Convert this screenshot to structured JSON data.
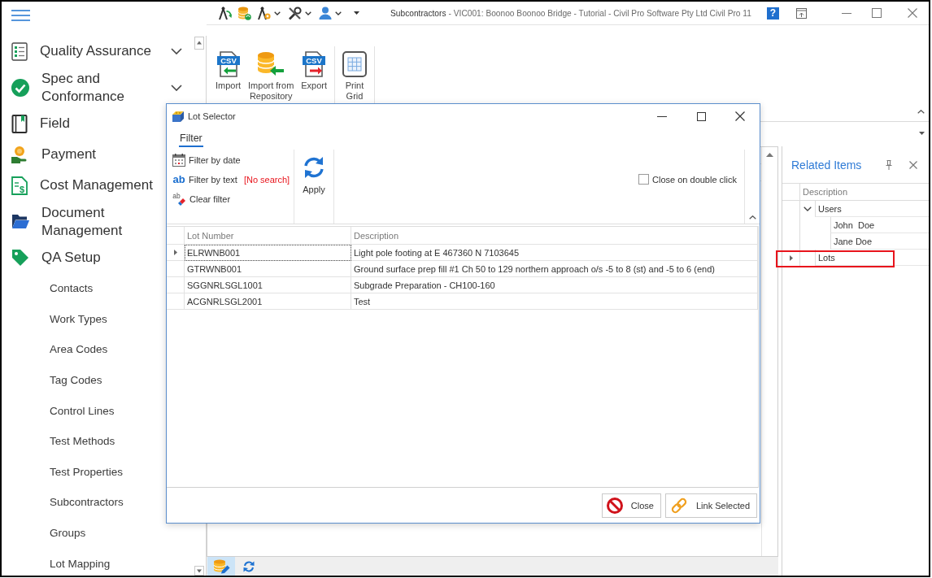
{
  "title_bar": {
    "module": "Subcontractors",
    "context": "- VIC001: Boonoo Boonoo Bridge - Tutorial - Civil Pro Software Pty Ltd Civil Pro 11",
    "help": "?"
  },
  "sidebar": {
    "items": [
      {
        "label": "Quality Assurance",
        "expanded": false
      },
      {
        "label": "Spec and Conformance",
        "expanded": false
      },
      {
        "label": "Field"
      },
      {
        "label": "Payment"
      },
      {
        "label": "Cost Management",
        "icon_text": "$"
      },
      {
        "label": "Document Management"
      },
      {
        "label": "QA Setup",
        "expanded": true,
        "children": [
          {
            "label": "Contacts"
          },
          {
            "label": "Work Types"
          },
          {
            "label": "Area Codes"
          },
          {
            "label": "Tag Codes"
          },
          {
            "label": "Control Lines"
          },
          {
            "label": "Test Methods"
          },
          {
            "label": "Test Properties"
          },
          {
            "label": "Subcontractors"
          },
          {
            "label": "Groups"
          },
          {
            "label": "Lot Mapping"
          }
        ]
      }
    ]
  },
  "ribbon": {
    "groups": [
      {
        "buttons": [
          {
            "label": "Import",
            "icon_text": "CSV"
          },
          {
            "label": "Import from Repository"
          },
          {
            "label": "Export",
            "icon_text": "CSV"
          }
        ]
      },
      {
        "buttons": [
          {
            "label": "Print Grid"
          }
        ]
      }
    ]
  },
  "lot_selector": {
    "title": "Lot Selector",
    "tabs": [
      {
        "label": "Filter",
        "selected": true
      }
    ],
    "filters": [
      {
        "label": "Filter by date"
      },
      {
        "label": "Filter by text",
        "icon_text": "ab",
        "status": "[No search]"
      },
      {
        "label": "Clear filter",
        "icon_text": "ab"
      }
    ],
    "apply": "Apply",
    "close_on_double_click": {
      "label": "Close on double click",
      "checked": false
    },
    "table": {
      "columns": [
        "Lot Number",
        "Description"
      ],
      "rows": [
        {
          "cells": [
            "ELRWNB001",
            "Light pole footing at E 467360 N 7103645"
          ],
          "selected": true
        },
        {
          "cells": [
            "GTRWNB001",
            "Ground surface prep fill #1 Ch 50 to 129 northern approach o/s -5 to 8 (st) and -5 to 6 (end)"
          ],
          "selected": false
        },
        {
          "cells": [
            "SGGNRLSGL1001",
            "Subgrade Preparation - CH100-160"
          ],
          "selected": false
        },
        {
          "cells": [
            "ACGNRLSGL2001",
            "Test"
          ],
          "selected": false
        }
      ]
    },
    "buttons": [
      {
        "label": "Close"
      },
      {
        "label": "Link Selected"
      }
    ]
  },
  "related_items": {
    "title": "Related Items",
    "columns": [
      "Description"
    ],
    "tree": [
      {
        "label": "Users",
        "expanded": true,
        "selected": false,
        "highlighted": false,
        "children": [
          {
            "label": "John  Doe",
            "selected": false,
            "highlighted": false
          },
          {
            "label": "Jane Doe",
            "selected": false,
            "highlighted": false
          }
        ]
      },
      {
        "label": "Lots",
        "selected": true,
        "highlighted": true
      }
    ]
  },
  "status_bar": {
    "tools": [
      {
        "selected": true
      },
      {
        "selected": false
      }
    ]
  }
}
